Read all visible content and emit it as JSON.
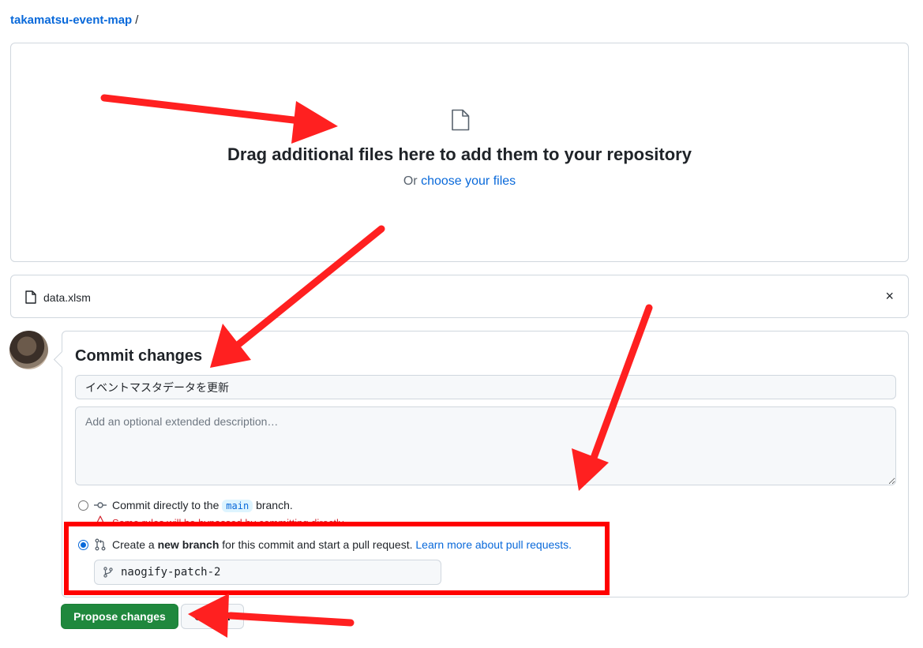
{
  "breadcrumb": {
    "repo": "takamatsu-event-map",
    "separator": "/"
  },
  "dropzone": {
    "title": "Drag additional files here to add them to your repository",
    "prefix": "Or",
    "link": "choose your files"
  },
  "file": {
    "name": "data.xlsm",
    "close_glyph": "×"
  },
  "commit": {
    "title": "Commit changes",
    "message_value": "イベントマスタデータを更新",
    "description_placeholder": "Add an optional extended description…",
    "option_direct": {
      "prefix": "Commit directly to the",
      "branch": "main",
      "suffix": "branch.",
      "warning": "Some rules will be bypassed by committing directly"
    },
    "option_new": {
      "prefix": "Create a",
      "bold": "new branch",
      "suffix": "for this commit and start a pull request.",
      "link": "Learn more about pull requests."
    },
    "branch_name": "naogify-patch-2"
  },
  "buttons": {
    "propose": "Propose changes",
    "cancel": "Cancel"
  },
  "colors": {
    "primary": "#1f883d",
    "link": "#0969da",
    "annotation": "#ff0000",
    "danger": "#d1242f"
  }
}
